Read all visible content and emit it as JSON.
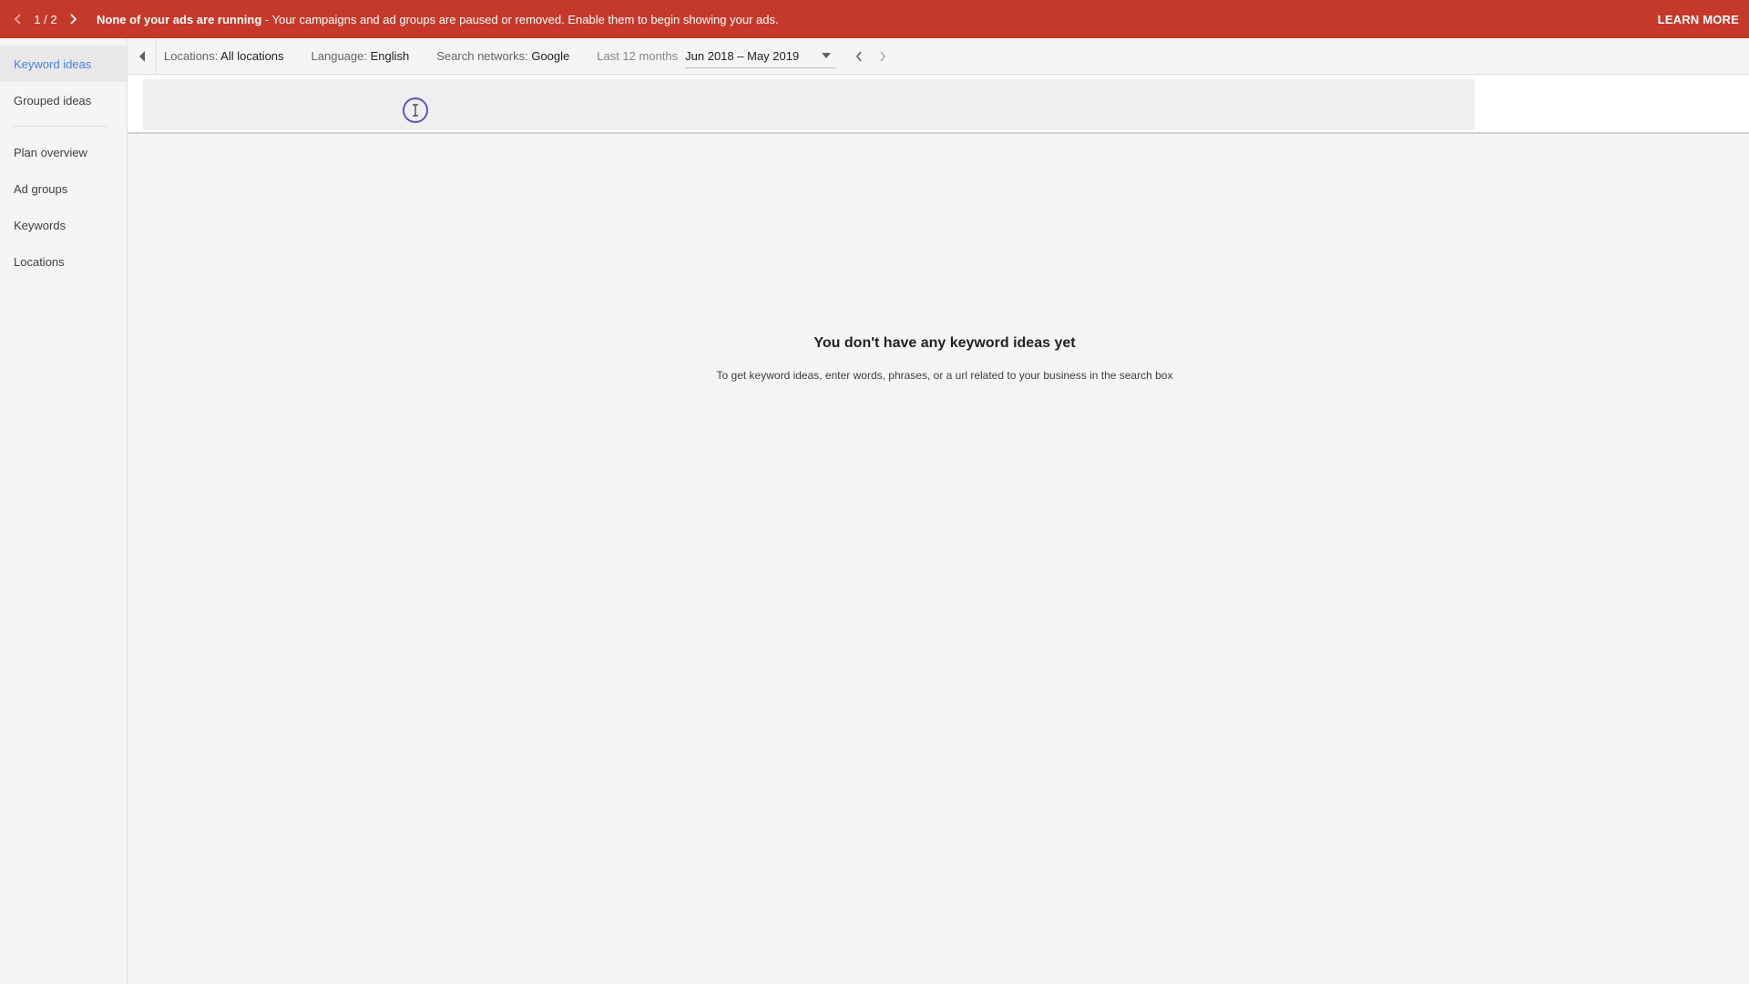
{
  "alert": {
    "pager": "1 / 2",
    "title": "None of your ads are running",
    "message": " - Your campaigns and ad groups are paused or removed. Enable them to begin showing your ads.",
    "learn_more": "LEARN MORE",
    "color": "#c5392a"
  },
  "sidebar": {
    "items_top": [
      {
        "label": "Keyword ideas",
        "active": true
      },
      {
        "label": "Grouped ideas",
        "active": false
      }
    ],
    "items_bottom": [
      {
        "label": "Plan overview"
      },
      {
        "label": "Ad groups"
      },
      {
        "label": "Keywords"
      },
      {
        "label": "Locations"
      }
    ],
    "accent": "#4a7fe0"
  },
  "toolbar": {
    "locations_label": "Locations:",
    "locations_value": "All locations",
    "language_label": "Language:",
    "language_value": "English",
    "networks_label": "Search networks:",
    "networks_value": "Google",
    "period_label": "Last 12 months",
    "period_value": "Jun 2018 – May 2019"
  },
  "search": {
    "placeholder": ""
  },
  "empty_state": {
    "title": "You don't have any keyword ideas yet",
    "message": "To get keyword ideas, enter words, phrases, or a url related to your business in the search box"
  }
}
